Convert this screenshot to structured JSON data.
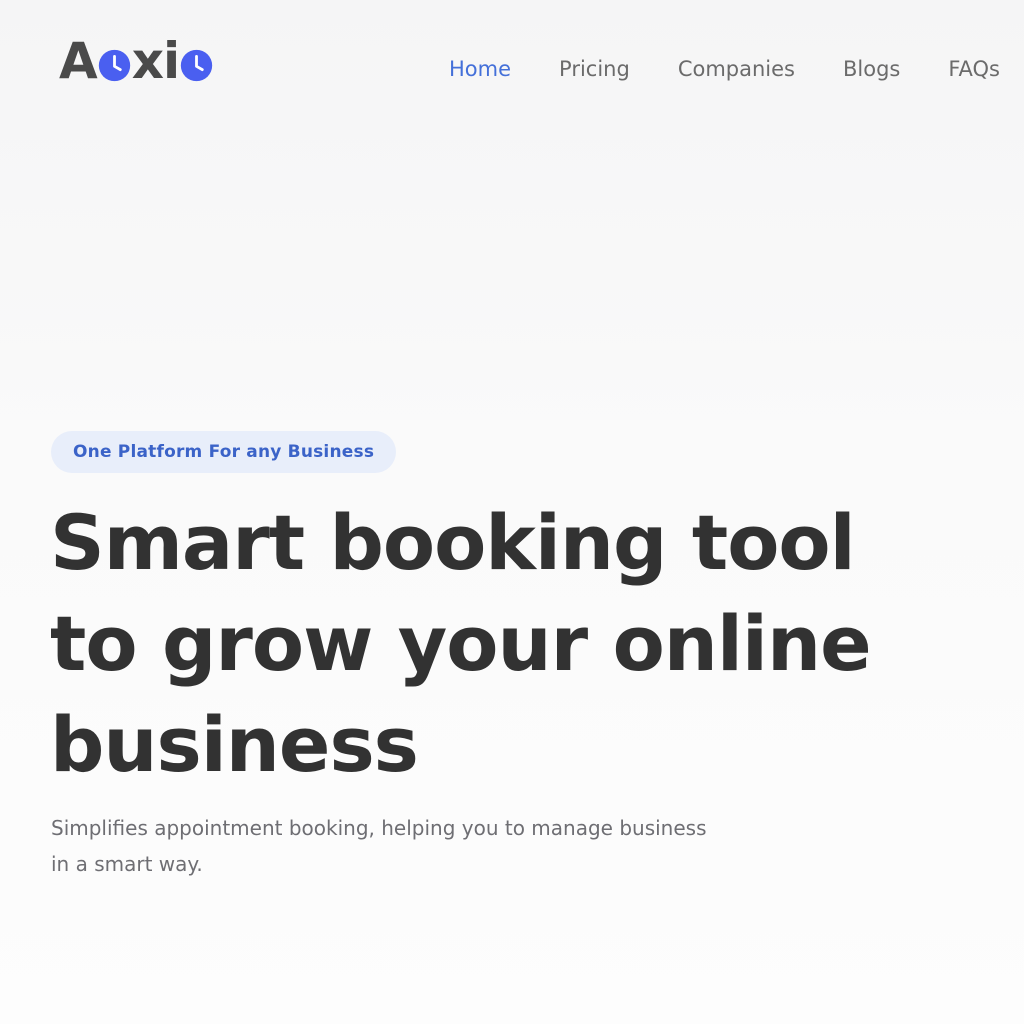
{
  "logo": {
    "letters": [
      "A",
      "x",
      "i"
    ],
    "icon_name": "clock-icon",
    "accent_color": "#4a5ff0"
  },
  "nav": {
    "items": [
      {
        "label": "Home",
        "active": true
      },
      {
        "label": "Pricing",
        "active": false
      },
      {
        "label": "Companies",
        "active": false
      },
      {
        "label": "Blogs",
        "active": false
      },
      {
        "label": "FAQs",
        "active": false
      }
    ],
    "active_color": "#4470d9"
  },
  "hero": {
    "badge": "One Platform For any Business",
    "title_lines": [
      "Smart booking tool",
      "to grow your online",
      "business"
    ],
    "subtitle_lines": [
      "Simplifies appointment booking, helping you to manage business",
      "in a smart way."
    ]
  }
}
